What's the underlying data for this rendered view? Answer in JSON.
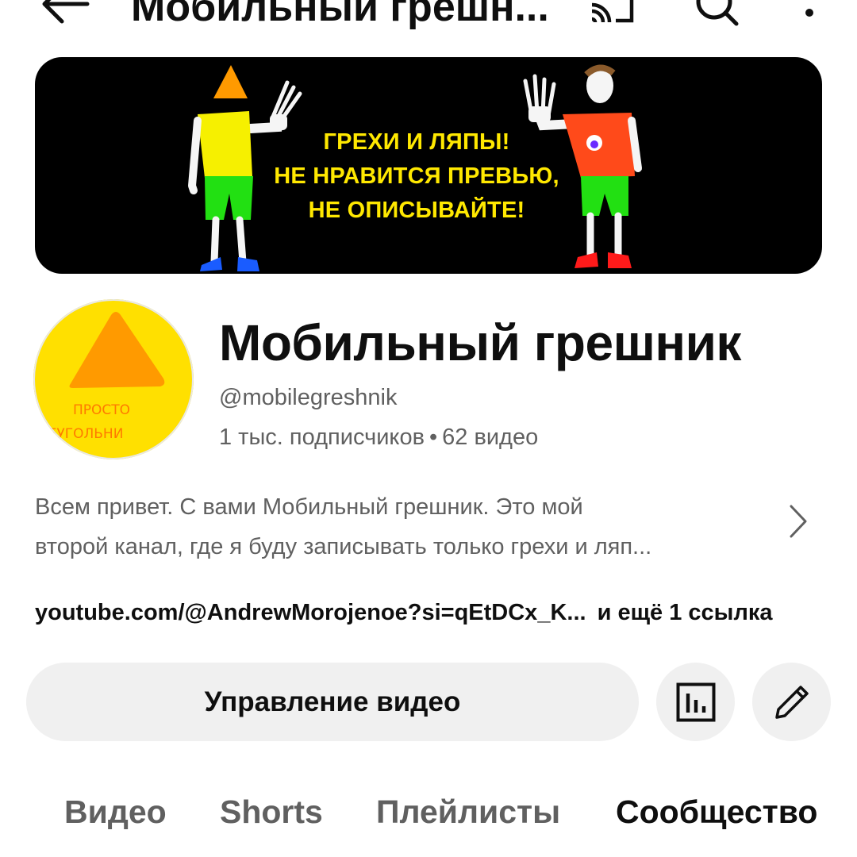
{
  "topbar": {
    "title": "Мобильный грешн..."
  },
  "icons": {
    "back": "arrow-back-icon",
    "cast": "cast-icon",
    "search": "search-icon",
    "more": "more-vert-icon",
    "chevron": "chevron-right-icon",
    "stats": "bar-chart-icon",
    "edit": "pencil-icon"
  },
  "banner": {
    "lines": [
      "ГРЕХИ И ЛЯПЫ!",
      "НЕ НРАВИТСЯ ПРЕВЬЮ,",
      "НЕ ОПИСЫВАЙТЕ!"
    ]
  },
  "avatar": {
    "lines": [
      "ПРОСТО",
      "ТРЕУГОЛЬНИ"
    ]
  },
  "channel": {
    "name": "Мобильный грешник",
    "handle": "@mobilegreshnik",
    "subscribers": "1 тыс. подписчиков",
    "separator": "•",
    "videos": "62 видео",
    "description_line1": "Всем привет. С вами Мобильный грешник. Это мой",
    "description_line2": "второй канал, где я буду записывать только грехи и ляп...",
    "link": "youtube.com/@AndrewMorojenoe?si=qEtDCx_K...",
    "more_links": "и ещё 1 ссылка"
  },
  "actions": {
    "manage_videos": "Управление видео"
  },
  "tabs": [
    "Видео",
    "Shorts",
    "Плейлисты",
    "Сообщество"
  ],
  "active_tab": "Сообщество",
  "colors": {
    "banner_bg": "#000000",
    "banner_text": "#ffe800",
    "avatar_bg": "#ffe000",
    "avatar_triangle": "#ff9a00",
    "button_bg": "#f0f0f0",
    "secondary_text": "#606060"
  }
}
